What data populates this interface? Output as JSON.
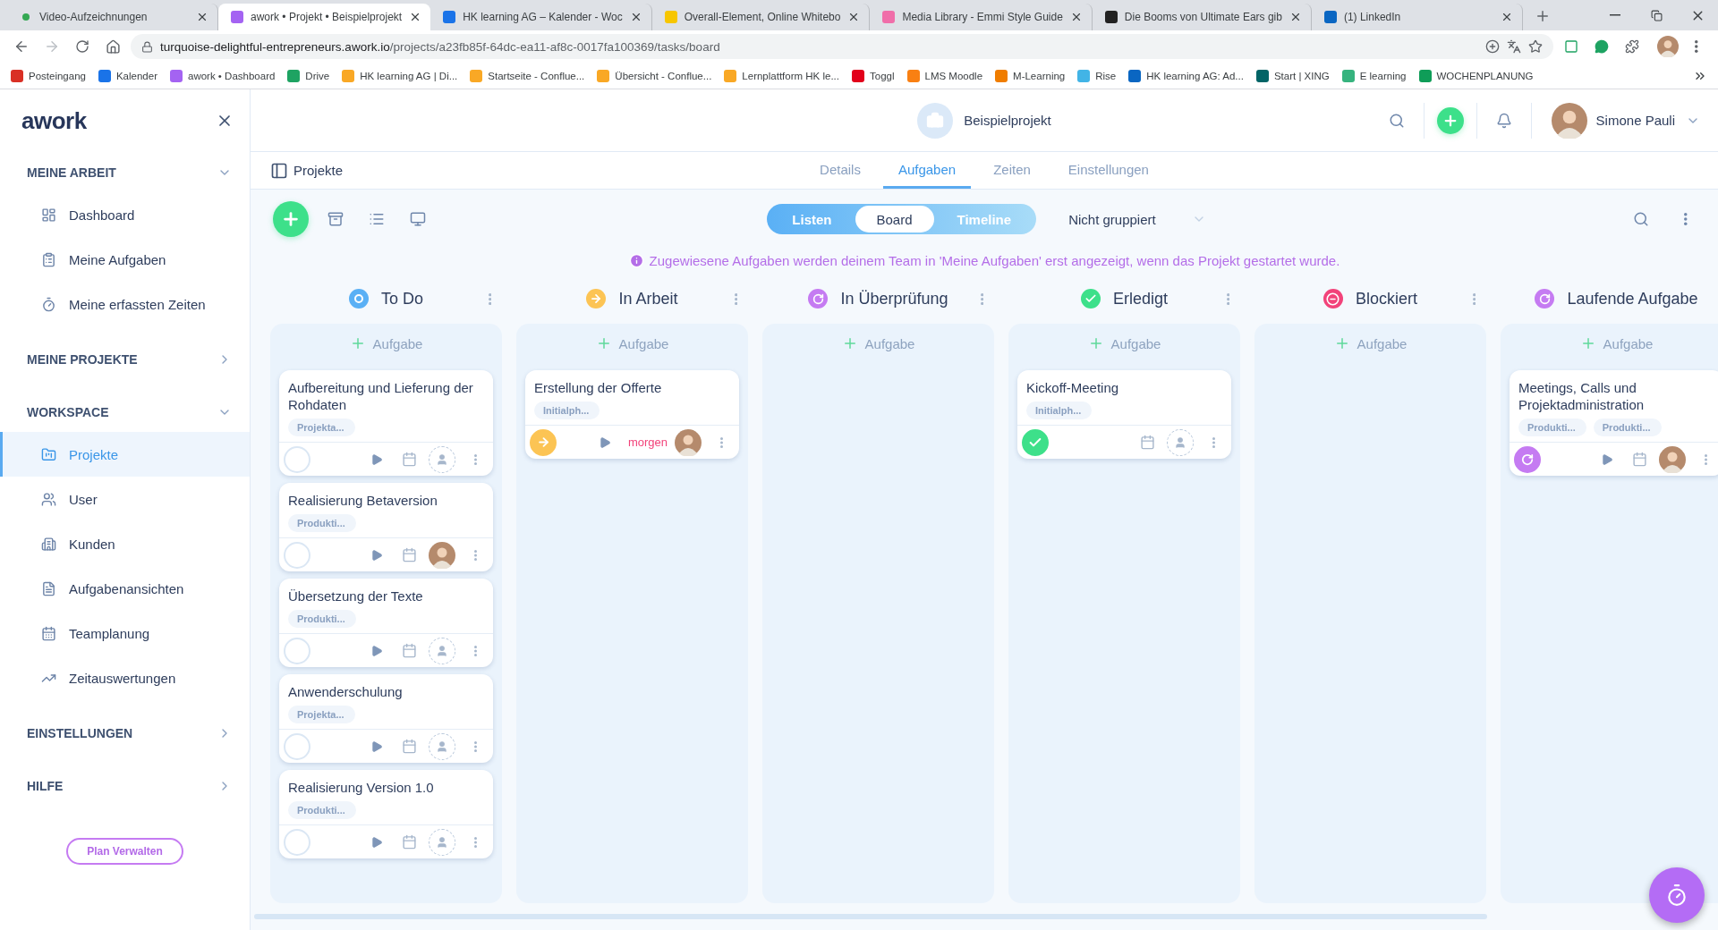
{
  "browser": {
    "tabs": [
      {
        "title": "Video-Aufzeichnungen",
        "color": "#34a853",
        "selected": false
      },
      {
        "title": "awork • Projekt • Beispielprojekt",
        "color": "#a463f2",
        "selected": true
      },
      {
        "title": "HK learning AG – Kalender - Woc",
        "color": "#1a73e8",
        "selected": false
      },
      {
        "title": "Overall-Element, Online Whitebo",
        "color": "#f7c600",
        "selected": false
      },
      {
        "title": "Media Library - Emmi Style Guide",
        "color": "#f06ea9",
        "selected": false
      },
      {
        "title": "Die Booms von Ultimate Ears gib",
        "color": "#222222",
        "selected": false
      },
      {
        "title": "(1) LinkedIn",
        "color": "#0a66c2",
        "selected": false
      }
    ],
    "url": {
      "host": "turquoise-delightful-entrepreneurs.awork.io",
      "path": "/projects/a23fb85f-64dc-ea11-af8c-0017fa100369/tasks/board"
    },
    "bookmarks": [
      {
        "label": "Posteingang",
        "color": "#d93025"
      },
      {
        "label": "Kalender",
        "color": "#1a73e8"
      },
      {
        "label": "awork • Dashboard",
        "color": "#a463f2"
      },
      {
        "label": "Drive",
        "color": "#1ea362"
      },
      {
        "label": "HK learning AG | Di...",
        "color": "#f9a825"
      },
      {
        "label": "Startseite - Conflue...",
        "color": "#f9a825"
      },
      {
        "label": "Übersicht - Conflue...",
        "color": "#f9a825"
      },
      {
        "label": "Lernplattform HK le...",
        "color": "#f9a825"
      },
      {
        "label": "Toggl",
        "color": "#e2001a"
      },
      {
        "label": "LMS Moodle",
        "color": "#f98012"
      },
      {
        "label": "M-Learning",
        "color": "#f07d00"
      },
      {
        "label": "Rise",
        "color": "#42b4e6"
      },
      {
        "label": "HK learning AG: Ad...",
        "color": "#0a66c2"
      },
      {
        "label": "Start | XING",
        "color": "#026466"
      },
      {
        "label": "E learning",
        "color": "#36b37e"
      },
      {
        "label": "WOCHENPLANUNG",
        "color": "#0f9d58"
      }
    ]
  },
  "sidebar": {
    "logo": "awork",
    "sections": [
      {
        "title": "MEINE ARBEIT",
        "expanded": true,
        "items": [
          {
            "label": "Dashboard",
            "selected": false
          },
          {
            "label": "Meine Aufgaben",
            "selected": false
          },
          {
            "label": "Meine erfassten Zeiten",
            "selected": false
          }
        ]
      },
      {
        "title": "MEINE PROJEKTE",
        "expanded": false
      },
      {
        "title": "WORKSPACE",
        "expanded": true,
        "items": [
          {
            "label": "Projekte",
            "selected": true
          },
          {
            "label": "User",
            "selected": false
          },
          {
            "label": "Kunden",
            "selected": false
          },
          {
            "label": "Aufgabenansichten",
            "selected": false
          },
          {
            "label": "Teamplanung",
            "selected": false
          },
          {
            "label": "Zeitauswertungen",
            "selected": false
          }
        ]
      },
      {
        "title": "EINSTELLUNGEN",
        "expanded": false
      },
      {
        "title": "HILFE",
        "expanded": false
      }
    ],
    "plan_button": "Plan Verwalten"
  },
  "header": {
    "project": "Beispielprojekt",
    "user": "Simone Pauli"
  },
  "subnav": {
    "breadcrumb": "Projekte",
    "tabs": [
      {
        "label": "Details",
        "selected": false
      },
      {
        "label": "Aufgaben",
        "selected": true
      },
      {
        "label": "Zeiten",
        "selected": false
      },
      {
        "label": "Einstellungen",
        "selected": false
      }
    ]
  },
  "toolbar": {
    "views": [
      {
        "label": "Listen",
        "selected": false
      },
      {
        "label": "Board",
        "selected": true
      },
      {
        "label": "Timeline",
        "selected": false
      }
    ],
    "grouping": "Nicht gruppiert"
  },
  "info": "Zugewiesene Aufgaben werden deinem Team in 'Meine Aufgaben' erst angezeigt, wenn das Projekt gestartet wurde.",
  "columns": [
    {
      "title": "To Do",
      "kind": "ring",
      "color": "#5ab0f5",
      "add_label": "Aufgabe",
      "cards": [
        {
          "title": "Aufbereitung und Lieferung der Rohdaten",
          "tags": [
            "Projekta..."
          ],
          "kind": "open",
          "timer": true,
          "assigned": false
        },
        {
          "title": "Realisierung Betaversion",
          "tags": [
            "Produkti..."
          ],
          "kind": "open",
          "timer": true,
          "assigned": true
        },
        {
          "title": "Übersetzung der Texte",
          "tags": [
            "Produkti..."
          ],
          "kind": "open",
          "timer": true,
          "assigned": false
        },
        {
          "title": "Anwenderschulung",
          "tags": [
            "Projekta..."
          ],
          "kind": "open",
          "timer": true,
          "assigned": false
        },
        {
          "title": "Realisierung Version 1.0",
          "tags": [
            "Produkti..."
          ],
          "kind": "open",
          "timer": true,
          "assigned": false
        }
      ]
    },
    {
      "title": "In Arbeit",
      "kind": "arrow",
      "color": "#fcc454",
      "add_label": "Aufgabe",
      "cards": [
        {
          "title": "Erstellung der Offerte",
          "tags": [
            "Initialph..."
          ],
          "kind": "progress",
          "timer": true,
          "due": "morgen",
          "assigned": true
        }
      ]
    },
    {
      "title": "In Überprüfung",
      "kind": "cycle",
      "color": "#c57bf2",
      "add_label": "Aufgabe"
    },
    {
      "title": "Erledigt",
      "kind": "check",
      "color": "#3de08a",
      "add_label": "Aufgabe",
      "cards": [
        {
          "title": "Kickoff-Meeting",
          "tags": [
            "Initialph..."
          ],
          "kind": "done",
          "timer": false,
          "assigned": false
        }
      ]
    },
    {
      "title": "Blockiert",
      "kind": "stop",
      "color": "#f2437a",
      "add_label": "Aufgabe"
    },
    {
      "title": "Laufende Aufgabe",
      "kind": "cycle",
      "color": "#c57bf2",
      "add_label": "Aufgabe",
      "cards": [
        {
          "title": "Meetings, Calls und Projektadministration",
          "tags": [
            "Produkti...",
            "Produkti..."
          ],
          "kind": "recurring",
          "timer": true,
          "assigned": true
        }
      ]
    }
  ]
}
